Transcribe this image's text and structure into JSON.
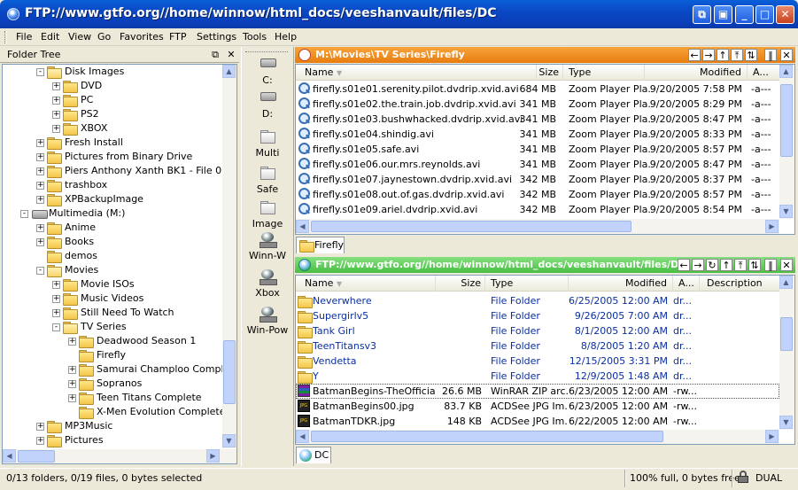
{
  "window": {
    "title": "FTP://www.gtfo.org//home/winnow/html_docs/veeshanvault/files/DC",
    "controls": [
      "⧉",
      "▣",
      "_",
      "□",
      "✕"
    ]
  },
  "menu": [
    "File",
    "Edit",
    "View",
    "Go",
    "Favorites",
    "FTP",
    "Settings",
    "Tools",
    "Help"
  ],
  "folder_tree": {
    "title": "Folder Tree",
    "items": [
      {
        "label": "Disk Images",
        "indent": 2,
        "exp": "-",
        "open": true
      },
      {
        "label": "DVD",
        "indent": 3,
        "exp": "+"
      },
      {
        "label": "PC",
        "indent": 3,
        "exp": "+"
      },
      {
        "label": "PS2",
        "indent": 3,
        "exp": "+"
      },
      {
        "label": "XBOX",
        "indent": 3,
        "exp": "+"
      },
      {
        "label": "Fresh Install",
        "indent": 2,
        "exp": "+"
      },
      {
        "label": "Pictures from Binary Drive",
        "indent": 2,
        "exp": "+"
      },
      {
        "label": "Piers Anthony Xanth BK1 - File 06 o",
        "indent": 2,
        "exp": "+"
      },
      {
        "label": "trashbox",
        "indent": 2,
        "exp": "+"
      },
      {
        "label": "XPBackupImage",
        "indent": 2,
        "exp": "+"
      },
      {
        "label": "Multimedia (M:)",
        "indent": 1,
        "exp": "-",
        "drive": true
      },
      {
        "label": "Anime",
        "indent": 2,
        "exp": "+"
      },
      {
        "label": "Books",
        "indent": 2,
        "exp": "+"
      },
      {
        "label": "demos",
        "indent": 2,
        "exp": ""
      },
      {
        "label": "Movies",
        "indent": 2,
        "exp": "-",
        "open": true
      },
      {
        "label": "Movie ISOs",
        "indent": 3,
        "exp": "+"
      },
      {
        "label": "Music Videos",
        "indent": 3,
        "exp": "+"
      },
      {
        "label": "Still Need To Watch",
        "indent": 3,
        "exp": "+"
      },
      {
        "label": "TV Series",
        "indent": 3,
        "exp": "-",
        "open": true
      },
      {
        "label": "Deadwood Season 1",
        "indent": 4,
        "exp": "+"
      },
      {
        "label": "Firefly",
        "indent": 4,
        "exp": ""
      },
      {
        "label": "Samurai Champloo Complet",
        "indent": 4,
        "exp": "+"
      },
      {
        "label": "Sopranos",
        "indent": 4,
        "exp": "+"
      },
      {
        "label": "Teen Titans Complete",
        "indent": 4,
        "exp": "+"
      },
      {
        "label": "X-Men Evolution Complete",
        "indent": 4,
        "exp": ""
      },
      {
        "label": "MP3Music",
        "indent": 2,
        "exp": "+"
      },
      {
        "label": "Pictures",
        "indent": 2,
        "exp": "+"
      }
    ]
  },
  "drive_bar": [
    {
      "label": "C:",
      "icon": "hard-drive-icon"
    },
    {
      "label": "D:",
      "icon": "hard-drive-icon"
    },
    {
      "label": "Multi",
      "icon": "folder-icon"
    },
    {
      "label": "Safe",
      "icon": "folder-icon"
    },
    {
      "label": "Image",
      "icon": "folder-icon"
    },
    {
      "label": "Winn-W",
      "icon": "network-drive-icon"
    },
    {
      "label": "Xbox",
      "icon": "network-drive-icon"
    },
    {
      "label": "Win-Pow",
      "icon": "network-drive-icon"
    }
  ],
  "top_pane": {
    "path": "M:\\Movies\\TV Series\\Firefly",
    "accent": "#f08a1c",
    "columns": [
      "Name",
      "Size",
      "Type",
      "Modified",
      "A..."
    ],
    "rows": [
      {
        "name": "firefly.s01e01.serenity.pilot.dvdrip.xvid.avi",
        "size": "684 MB",
        "type": "Zoom Player Pla...",
        "modified": "9/20/2005 7:58 PM",
        "attr": "-a---"
      },
      {
        "name": "firefly.s01e02.the.train.job.dvdrip.xvid.avi",
        "size": "341 MB",
        "type": "Zoom Player Pla...",
        "modified": "9/20/2005 8:29 PM",
        "attr": "-a---"
      },
      {
        "name": "firefly.s01e03.bushwhacked.dvdrip.xvid.avi",
        "size": "341 MB",
        "type": "Zoom Player Pla...",
        "modified": "9/20/2005 8:47 PM",
        "attr": "-a---"
      },
      {
        "name": "firefly.s01e04.shindig.avi",
        "size": "341 MB",
        "type": "Zoom Player Pla...",
        "modified": "9/20/2005 8:33 PM",
        "attr": "-a---"
      },
      {
        "name": "firefly.s01e05.safe.avi",
        "size": "341 MB",
        "type": "Zoom Player Pla...",
        "modified": "9/20/2005 8:57 PM",
        "attr": "-a---"
      },
      {
        "name": "firefly.s01e06.our.mrs.reynolds.avi",
        "size": "341 MB",
        "type": "Zoom Player Pla...",
        "modified": "9/20/2005 8:47 PM",
        "attr": "-a---"
      },
      {
        "name": "firefly.s01e07.jaynestown.dvdrip.xvid.avi",
        "size": "342 MB",
        "type": "Zoom Player Pla...",
        "modified": "9/20/2005 8:37 PM",
        "attr": "-a---"
      },
      {
        "name": "firefly.s01e08.out.of.gas.dvdrip.xvid.avi",
        "size": "342 MB",
        "type": "Zoom Player Pla...",
        "modified": "9/20/2005 8:57 PM",
        "attr": "-a---"
      },
      {
        "name": "firefly.s01e09.ariel.dvdrip.xvid.avi",
        "size": "342 MB",
        "type": "Zoom Player Pla...",
        "modified": "9/20/2005 8:54 PM",
        "attr": "-a---"
      }
    ],
    "tab": "Firefly"
  },
  "bottom_pane": {
    "path": "FTP://www.gtfo.org//home/winnow/html_docs/veeshanvault/files/DC",
    "accent": "#5fce5a",
    "columns": [
      "Name",
      "Size",
      "Type",
      "Modified",
      "A...",
      "Description"
    ],
    "rows": [
      {
        "name": "Neverwhere",
        "size": "",
        "type": "File Folder",
        "modified": "6/25/2005 12:00 AM",
        "attr": "dr...",
        "kind": "folder"
      },
      {
        "name": "Supergirlv5",
        "size": "",
        "type": "File Folder",
        "modified": "9/26/2005 7:00 AM",
        "attr": "dr...",
        "kind": "folder"
      },
      {
        "name": "Tank Girl",
        "size": "",
        "type": "File Folder",
        "modified": "8/1/2005 12:00 AM",
        "attr": "dr...",
        "kind": "folder"
      },
      {
        "name": "TeenTitansv3",
        "size": "",
        "type": "File Folder",
        "modified": "8/8/2005 1:20 AM",
        "attr": "dr...",
        "kind": "folder"
      },
      {
        "name": "Vendetta",
        "size": "",
        "type": "File Folder",
        "modified": "12/15/2005 3:31 PM",
        "attr": "dr...",
        "kind": "folder"
      },
      {
        "name": "Y",
        "size": "",
        "type": "File Folder",
        "modified": "12/9/2005 1:48 AM",
        "attr": "dr...",
        "kind": "folder"
      },
      {
        "name": "BatmanBegins-TheOfficial...",
        "size": "26.6 MB",
        "type": "WinRAR ZIP arc...",
        "modified": "6/23/2005 12:00 AM",
        "attr": "-rw...",
        "kind": "rar"
      },
      {
        "name": "BatmanBegins00.jpg",
        "size": "83.7 KB",
        "type": "ACDSee JPG Im...",
        "modified": "6/23/2005 12:00 AM",
        "attr": "-rw...",
        "kind": "jpg"
      },
      {
        "name": "BatmanTDKR.jpg",
        "size": "148 KB",
        "type": "ACDSee JPG Im...",
        "modified": "6/22/2005 12:00 AM",
        "attr": "-rw...",
        "kind": "jpg"
      }
    ],
    "tab": "DC"
  },
  "status": {
    "left": "0/13 folders, 0/19 files, 0 bytes selected",
    "space": "100% full, 0 bytes free",
    "mode": "DUAL"
  }
}
